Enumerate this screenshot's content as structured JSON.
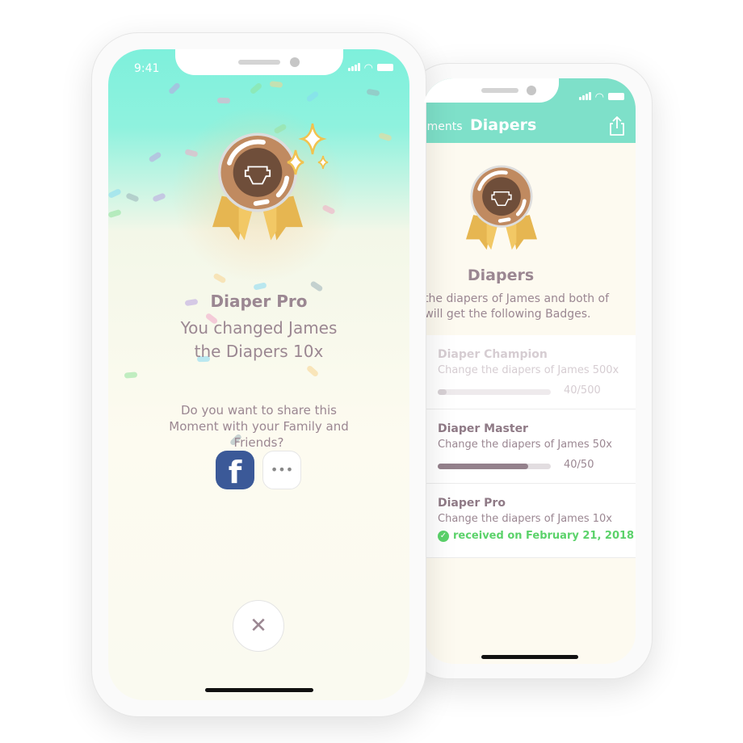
{
  "colors": {
    "accent": "#7ee0c9",
    "success": "#5bd26a",
    "text": "#9b8792",
    "facebook": "#3b5998"
  },
  "back_phone": {
    "nav": {
      "back_label": "ements",
      "title": "Diapers",
      "share_icon": "share-icon"
    },
    "header": {
      "title": "Diapers",
      "description_line1": "e the diapers of James and both of",
      "description_line2": "u will get the following Badges."
    },
    "badges": [
      {
        "name": "Diaper Champion",
        "description": "Change the diapers of James 500x",
        "progress_text": "40/500",
        "progress": 0.08,
        "locked": true
      },
      {
        "name": "Diaper Master",
        "description": "Change the diapers of James 50x",
        "progress_text": "40/50",
        "progress": 0.8,
        "locked": false
      },
      {
        "name": "Diaper Pro",
        "description": "Change the diapers of James 10x",
        "received": "received on February 21, 2018"
      }
    ]
  },
  "front_phone": {
    "status": {
      "time": "9:41"
    },
    "badge_title": "Diaper Pro",
    "message": "You changed James the Diapers 10x",
    "share_prompt": "Do you want to share this Moment with your Family and Friends?",
    "share_buttons": {
      "facebook": "f",
      "more": "•••"
    },
    "close": "✕"
  }
}
